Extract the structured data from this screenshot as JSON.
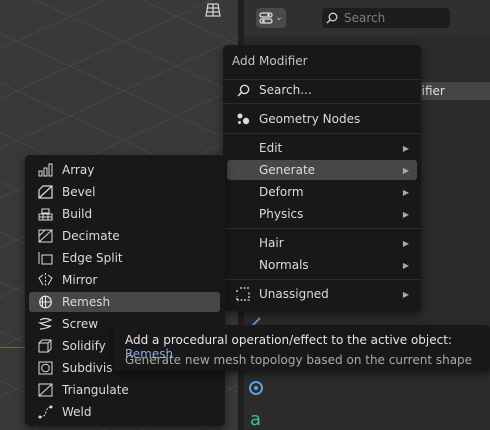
{
  "properties": {
    "search_placeholder": "Search",
    "modifier_row_text": "difier"
  },
  "add_menu": {
    "title": "Add Modifier",
    "items": [
      {
        "label": "Search...",
        "icon": "search-icon",
        "submenu": false
      },
      {
        "label": "Geometry Nodes",
        "icon": "geometry-nodes-icon",
        "submenu": false
      },
      {
        "label": "Edit",
        "icon": "",
        "submenu": true
      },
      {
        "label": "Generate",
        "icon": "",
        "submenu": true,
        "active": true
      },
      {
        "label": "Deform",
        "icon": "",
        "submenu": true
      },
      {
        "label": "Physics",
        "icon": "",
        "submenu": true
      },
      {
        "label": "Hair",
        "icon": "",
        "submenu": true
      },
      {
        "label": "Normals",
        "icon": "",
        "submenu": true
      },
      {
        "label": "Unassigned",
        "icon": "unassigned-icon",
        "submenu": true
      }
    ],
    "arrow": "▶"
  },
  "generate_menu": {
    "items": [
      {
        "label": "Array",
        "icon": "array-icon"
      },
      {
        "label": "Bevel",
        "icon": "bevel-icon"
      },
      {
        "label": "Build",
        "icon": "build-icon"
      },
      {
        "label": "Decimate",
        "icon": "decimate-icon"
      },
      {
        "label": "Edge Split",
        "icon": "edge-split-icon"
      },
      {
        "label": "Mirror",
        "icon": "mirror-icon"
      },
      {
        "label": "Remesh",
        "icon": "remesh-icon",
        "active": true
      },
      {
        "label": "Screw",
        "icon": "screw-icon"
      },
      {
        "label": "Solidify",
        "icon": "solidify-icon"
      },
      {
        "label": "Subdivis",
        "icon": "subdivision-icon"
      },
      {
        "label": "Triangulate",
        "icon": "triangulate-icon"
      },
      {
        "label": "Weld",
        "icon": "weld-icon"
      }
    ]
  },
  "tooltip": {
    "line1_prefix": "Add a procedural operation/effect to the active object: ",
    "line1_keyword": "Remesh",
    "line2": "Generate new mesh topology based on the current shape"
  },
  "colors": {
    "menu_bg": "#181818",
    "highlight": "#474747",
    "keyword": "#86aee0"
  }
}
